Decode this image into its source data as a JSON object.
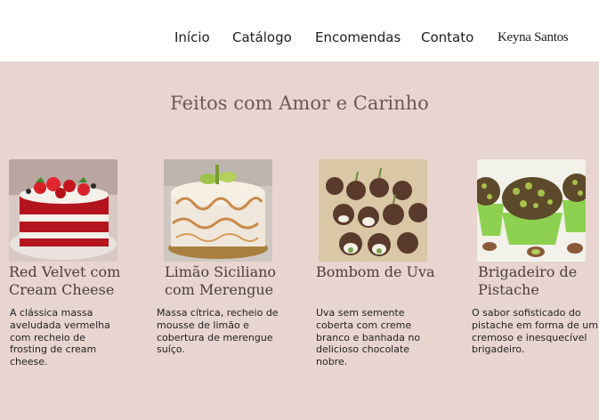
{
  "nav": {
    "items": [
      "Início",
      "Catálogo",
      "Encomendas",
      "Contato"
    ],
    "brand": "Keyna Santos"
  },
  "section": {
    "title": "Feitos com Amor e Carinho"
  },
  "products": [
    {
      "title_line1": "Red Velvet com",
      "title_line2": "Cream Cheese",
      "desc_lines": [
        "A clássica massa",
        "aveludada vermelha",
        "com recheio de",
        "frosting de cream",
        "cheese."
      ],
      "image": "red-velvet-cake-photo"
    },
    {
      "title_line1": "Limão Siciliano",
      "title_line2": "com Merengue",
      "desc_lines": [
        "Massa cítrica, recheio de",
        "mousse de limão e",
        "cobertura de merengue",
        "suíço."
      ],
      "image": "lemon-meringue-cake-photo"
    },
    {
      "title_line1": "Bombom de Uva",
      "title_line2": "",
      "desc_lines": [
        "Uva sem semente",
        "coberta com creme",
        "branco e banhada no",
        "delicioso chocolate",
        "nobre."
      ],
      "image": "grape-bonbon-photo"
    },
    {
      "title_line1": "Brigadeiro de",
      "title_line2": "Pistache",
      "desc_lines": [
        "O sabor sofisticado do",
        "pistache em forma de um",
        "cremoso e inesquecível",
        "brigadeiro."
      ],
      "image": "pistachio-brigadeiro-photo"
    }
  ],
  "colors": {
    "background": "#e8d5cf",
    "header": "#ffffff",
    "heading": "#6b5a55",
    "title": "#4d3e3a"
  }
}
